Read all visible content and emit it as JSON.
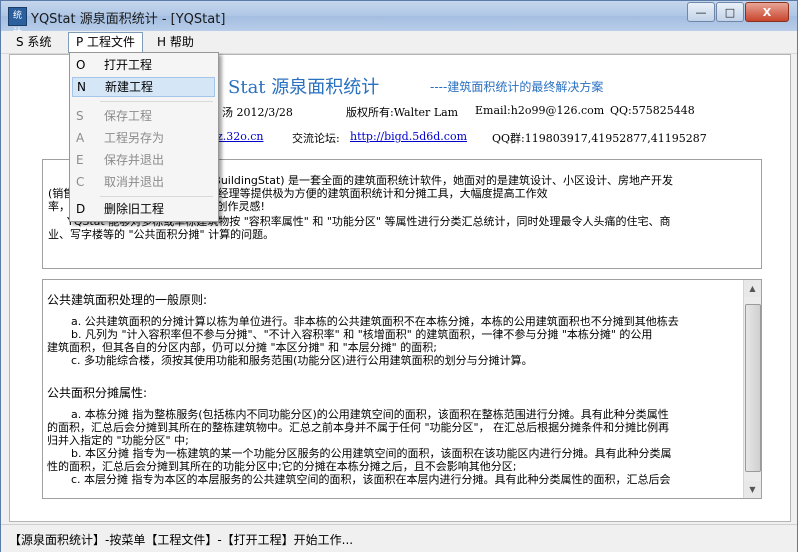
{
  "window": {
    "title": "YQStat 源泉面积统计 - [YQStat]",
    "icon_text": "统计",
    "minimize": "—",
    "maximize": "□",
    "close": "X"
  },
  "menubar": [
    "S 系统",
    "P 工程文件",
    "H 帮助"
  ],
  "dropdown": {
    "items": [
      {
        "key": "O",
        "label": "打开工程",
        "enabled": true
      },
      {
        "key": "N",
        "label": "新建工程",
        "enabled": true,
        "highlighted": true
      },
      {
        "key": "S",
        "label": "保存工程",
        "enabled": false
      },
      {
        "key": "A",
        "label": "工程另存为",
        "enabled": false
      },
      {
        "key": "E",
        "label": "保存并退出",
        "enabled": false
      },
      {
        "key": "C",
        "label": "取消并退出",
        "enabled": false
      },
      {
        "key": "D",
        "label": "删除旧工程",
        "enabled": true
      }
    ]
  },
  "header": {
    "title": "Stat 源泉面积统计",
    "subtitle": "----建筑面积统计的最终解决方案",
    "date_fragment": "汤  2012/3/28",
    "copyright": "版权所有:Walter Lam",
    "email": "Email:h2o99@126.com",
    "qq": "QQ:575825448",
    "site_fragment": "z.32o.cn",
    "forum_label": "交流论坛:",
    "forum_link": "http://bigd.5d6d.com",
    "qq_group": "QQ群:119803917,41952877,41195287"
  },
  "intro": {
    "line1": "(MyBuildingStat) 是一套全面的建筑面积统计软件，她面对的是建筑设计、小区设计、房地产开发",
    "line2": "(销售        t 能给建筑师、规划师、项目经理等提供极为方便的建筑面积统计和分摊工具，大幅度提高工作效",
    "line3": "率，            开繁琐枯燥的数学计算，释放创作灵感!",
    "line4": "YQStat 能够对多栋或单栋建筑物按 \"容积率属性\" 和 \"功能分区\" 等属性进行分类汇总统计，同时处理最令人头痛的住宅、商",
    "line5": "业、写字楼等的 \"公共面积分摊\" 计算的问题。"
  },
  "rules": {
    "heading1": "公共建筑面积处理的一般原则:",
    "a1": "a. 公共建筑面积的分摊计算以栋为单位进行。非本栋的公共建筑面积不在本栋分摊，本栋的公用建筑面积也不分摊到其他栋去",
    "b1": "b. 凡列为 \"计入容积率但不参与分摊\"、\"不计入容积率\" 和 \"核增面积\" 的建筑面积，一律不参与分摊 \"本栋分摊\" 的公用",
    "b1_cont": "建筑面积，但其各自的分区内部，仍可以分摊 \"本区分摊\" 和 \"本层分摊\" 的面积;",
    "c1": "c. 多功能综合楼，须按其使用功能和服务范围(功能分区)进行公用建筑面积的划分与分摊计算。",
    "heading2": "公共面积分摊属性:",
    "a2": "a. 本栋分摊  指为整栋服务(包括栋内不同功能分区)的公用建筑空间的面积，该面积在整栋范围进行分摊。具有此种分类属性",
    "a2_cont1": "的面积，汇总后会分摊到其所在的整栋建筑物中。汇总之前本身并不属于任何 \"功能分区\"，  在汇总后根据分摊条件和分摊比例再",
    "a2_cont2": "归并入指定的 \"功能分区\" 中;",
    "b2": "b. 本区分摊  指专为一栋建筑的某一个功能分区服务的公用建筑空间的面积，该面积在该功能区内进行分摊。具有此种分类属",
    "b2_cont": "性的面积，汇总后会分摊到其所在的功能分区中;它的分摊在本栋分摊之后，且不会影响其他分区;",
    "c2": "c. 本层分摊  指专为本区的本层服务的公共建筑空间的面积，该面积在本层内进行分摊。具有此种分类属性的面积，汇总后会"
  },
  "status": "【源泉面积统计】-按菜单【工程文件】-【打开工程】开始工作..."
}
